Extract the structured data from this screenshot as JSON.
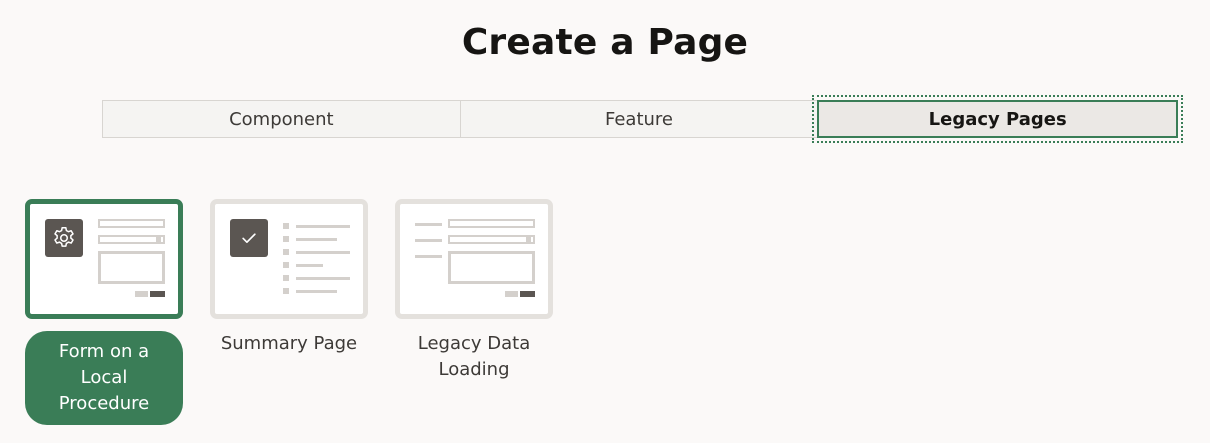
{
  "title": "Create a Page",
  "tabs": [
    {
      "label": "Component",
      "active": false
    },
    {
      "label": "Feature",
      "active": false
    },
    {
      "label": "Legacy Pages",
      "active": true
    }
  ],
  "cards": [
    {
      "label": "Form on a Local Procedure",
      "icon": "gear-icon",
      "selected": true
    },
    {
      "label": "Summary Page",
      "icon": "check-icon",
      "selected": false
    },
    {
      "label": "Legacy Data Loading",
      "icon": "",
      "selected": false
    }
  ],
  "colors": {
    "accent": "#3a7d57",
    "icon_bg": "#5b5652",
    "placeholder": "#d4d0cc",
    "background": "#fbf9f8"
  }
}
